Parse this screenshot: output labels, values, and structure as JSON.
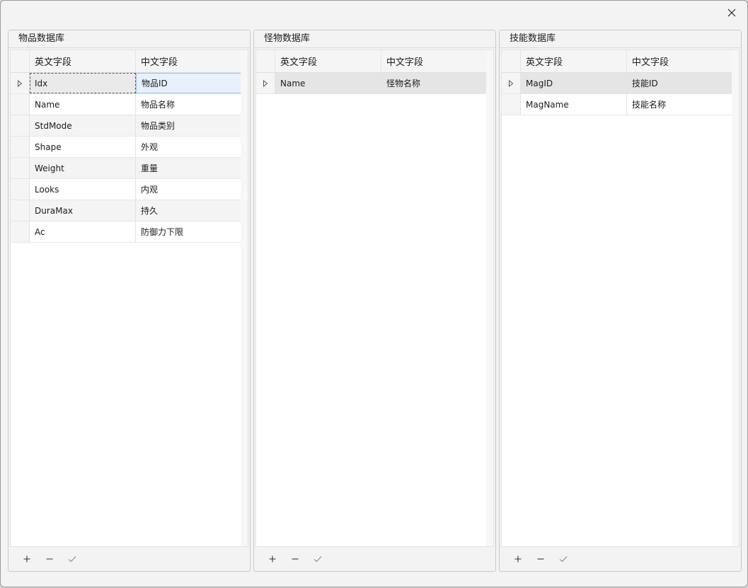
{
  "panels": [
    {
      "title": "物品数据库",
      "columns": [
        "英文字段",
        "中文字段"
      ],
      "rows": [
        {
          "en": "Idx",
          "zh": "物品ID"
        },
        {
          "en": "Name",
          "zh": "物品名称"
        },
        {
          "en": "StdMode",
          "zh": "物品类别"
        },
        {
          "en": "Shape",
          "zh": "外观"
        },
        {
          "en": "Weight",
          "zh": "重量"
        },
        {
          "en": "Looks",
          "zh": "内观"
        },
        {
          "en": "DuraMax",
          "zh": "持久"
        },
        {
          "en": "Ac",
          "zh": "防御力下限"
        }
      ]
    },
    {
      "title": "怪物数据库",
      "columns": [
        "英文字段",
        "中文字段"
      ],
      "rows": [
        {
          "en": "Name",
          "zh": "怪物名称"
        }
      ]
    },
    {
      "title": "技能数据库",
      "columns": [
        "英文字段",
        "中文字段"
      ],
      "rows": [
        {
          "en": "MagID",
          "zh": "技能ID"
        },
        {
          "en": "MagName",
          "zh": "技能名称"
        }
      ]
    }
  ],
  "icons": {
    "close": "close-icon",
    "add": "plus-icon",
    "remove": "minus-icon",
    "confirm": "check-icon",
    "row_indicator": "triangle-right-icon"
  }
}
